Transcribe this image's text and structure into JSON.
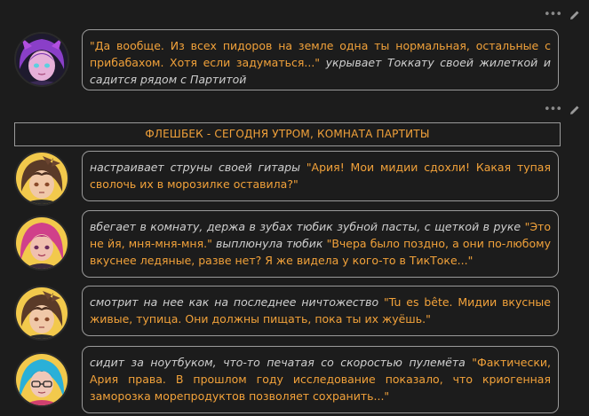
{
  "posts": [
    {
      "speech_1": "\"Да вообще. Из всех пидоров на земле одна ты нормальная, остальные с прибабахом. Хотя если задуматься...\"",
      "action_1": " укрывает Токкату своей жилеткой и садится рядом с Партитой",
      "avatar_icon": "purple-haired-character-avatar"
    },
    {
      "action_1": "настраивает струны своей гитары ",
      "speech_1": "\"Ария! Мои мидии сдохли! Какая тупая сволочь их в морозилке оставила?\"",
      "avatar_icon": "brown-haired-character-avatar"
    },
    {
      "action_1": "вбегает в комнату, держа в зубах тюбик зубной пасты, с щеткой в руке ",
      "speech_1": "\"Это не йя, мня-мня-мня.\"",
      "action_2": " выплюнула тюбик ",
      "speech_2": "\"Вчера было поздно, а они по-любому вкуснее ледяные, разве нет? Я же видела у кого-то в ТикТоке...\"",
      "avatar_icon": "pink-haired-character-avatar"
    },
    {
      "action_1": "смотрит на нее как на последнее ничтожество ",
      "speech_1": "\"Tu es bête. Мидии вкусные живые, тупица. Они должны пищать, пока ты их жуёшь.\"",
      "avatar_icon": "brown-haired-character-avatar"
    },
    {
      "action_1": "сидит за ноутбуком, что-то печатая со скоростью пулемёта ",
      "speech_1": "\"Фактически, Ария права. В прошлом году исследование показало, что криогенная заморозка морепродуктов позволяет сохранить...\"",
      "avatar_icon": "blue-haired-character-avatar"
    }
  ],
  "banner": {
    "text": "ФЛЕШБЕК - СЕГОДНЯ УТРОМ, КОМНАТА ПАРТИТЫ"
  },
  "toolbar": {
    "more_icon": "more-dots-icon",
    "edit_icon": "pencil-edit-icon",
    "more_glyph": "•••"
  },
  "colors": {
    "background": "#1c1c1c",
    "speech": "#f2a23a",
    "action": "#cfcfcf",
    "border": "#9a9a9a"
  }
}
